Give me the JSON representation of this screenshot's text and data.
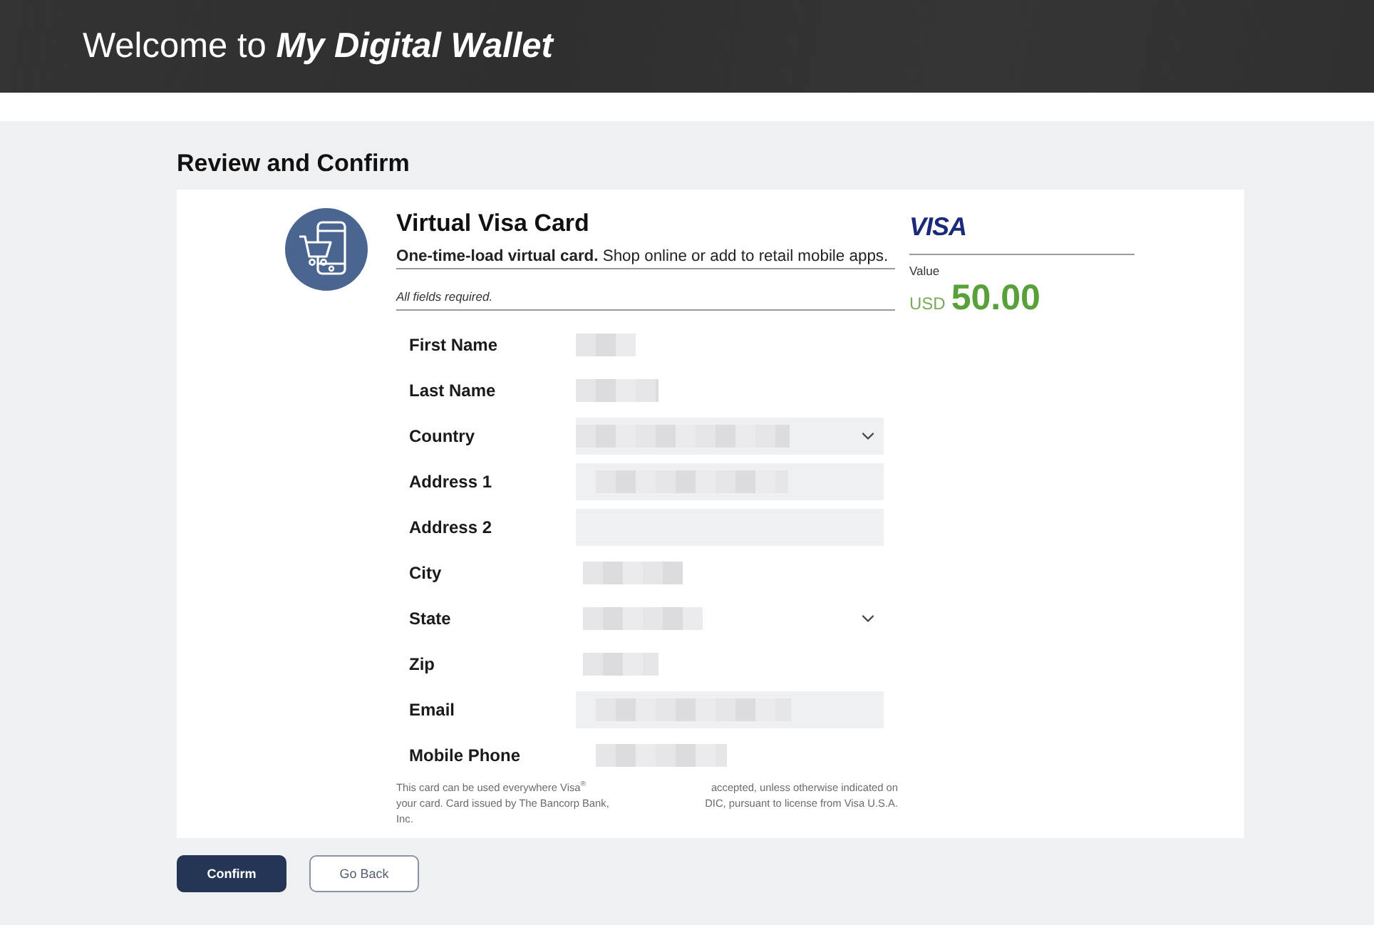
{
  "header": {
    "title": "Welcome to **My Digital Wallet**"
  },
  "page": {
    "heading": "Review and Confirm"
  },
  "card": {
    "title": "Virtual Visa Card",
    "description": "**One-time-load virtual card.** Shop online or add to retail mobile apps.",
    "required_note": "All fields required.",
    "brand": "VISA",
    "value_label": "Value",
    "currency": "USD",
    "amount": "50.00"
  },
  "fields": [
    {
      "label": "First Name",
      "kind": "text",
      "shaded": false
    },
    {
      "label": "Last Name",
      "kind": "text",
      "shaded": false
    },
    {
      "label": "Country",
      "kind": "select",
      "shaded": true
    },
    {
      "label": "Address 1",
      "kind": "text",
      "shaded": true
    },
    {
      "label": "Address 2",
      "kind": "text",
      "shaded": true
    },
    {
      "label": "City",
      "kind": "text",
      "shaded": false
    },
    {
      "label": "State",
      "kind": "select",
      "shaded": false
    },
    {
      "label": "Zip",
      "kind": "text",
      "shaded": false
    },
    {
      "label": "Email",
      "kind": "text",
      "shaded": true
    },
    {
      "label": "Mobile Phone",
      "kind": "text",
      "shaded": false
    }
  ],
  "disclaimer": {
    "lines": [
      [
        "This card can be used everywhere Visa$^{®}$",
        "accepted, unless otherwise indicated on"
      ],
      [
        "your card. Card issued by The Bancorp Bank,",
        "DIC, pursuant to license from Visa U.S.A."
      ],
      [
        "Inc."
      ]
    ]
  },
  "buttons": [
    {
      "label": "Confirm",
      "kind": "primary"
    },
    {
      "label": "Go Back",
      "kind": "secondary"
    }
  ]
}
